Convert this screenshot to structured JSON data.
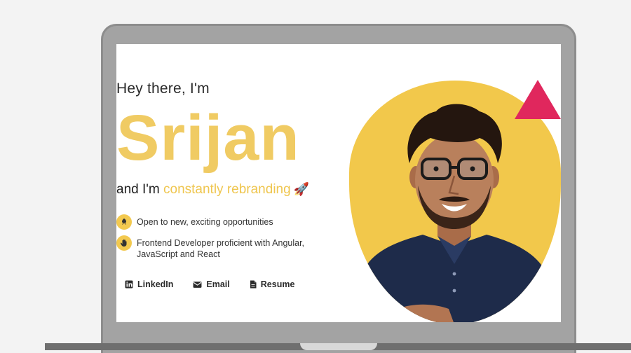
{
  "hero": {
    "greeting": "Hey there, I'm",
    "name": "Srijan",
    "tagline_prefix": "and I'm ",
    "tagline_accent": "constantly rebranding",
    "tagline_emoji": "🚀"
  },
  "features": [
    {
      "icon": "rocket-icon",
      "text": "Open to new, exciting opportunities"
    },
    {
      "icon": "hand-icon",
      "text": "Frontend Developer proficient with Angular, JavaScript and React"
    }
  ],
  "links": [
    {
      "icon": "linkedin-icon",
      "label": "LinkedIn"
    },
    {
      "icon": "email-icon",
      "label": "Email"
    },
    {
      "icon": "document-icon",
      "label": "Resume"
    }
  ],
  "colors": {
    "accent_yellow": "#f0cb63",
    "triangle_pink": "#e0275d",
    "laptop_gray": "#a3a3a3"
  }
}
